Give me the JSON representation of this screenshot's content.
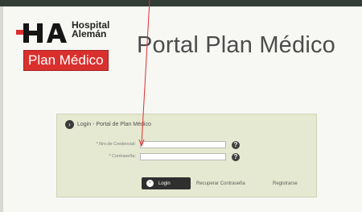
{
  "logo": {
    "mark_text": "HA",
    "name_line1": "Hospital",
    "name_line2": "Alemán",
    "badge": "Plan Médico"
  },
  "header": {
    "title": "Portal Plan Médico"
  },
  "login": {
    "title": "Login - Portal de Plan Médico",
    "username_label": "* Nro.de Credencial:",
    "username_value": "",
    "password_label": "* Contraseña:",
    "password_value": "",
    "help_icon": "question-icon",
    "login_button": "Login",
    "recover_link": "Recuperar Contraseña",
    "register_link": "Registrarse"
  },
  "colors": {
    "topbar": "#313d35",
    "brand_red": "#d9302e",
    "panel_bg": "#e6e9d1",
    "pointer": "#e03030"
  }
}
